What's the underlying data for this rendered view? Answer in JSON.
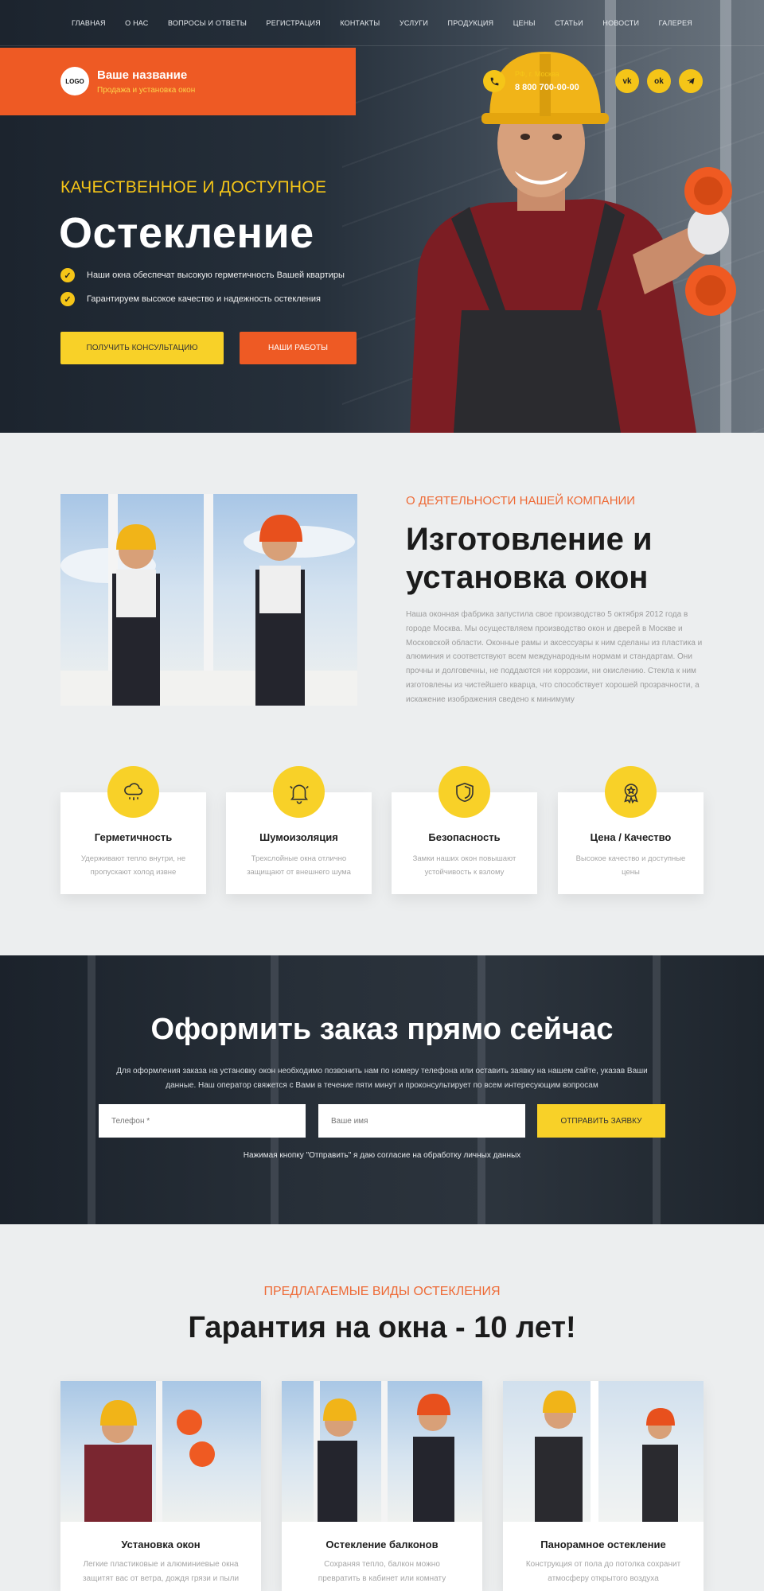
{
  "nav": [
    "ГЛАВНАЯ",
    "О НАС",
    "ВОПРОСЫ И ОТВЕТЫ",
    "РЕГИСТРАЦИЯ",
    "КОНТАКТЫ",
    "УСЛУГИ",
    "ПРОДУКЦИЯ",
    "ЦЕНЫ",
    "СТАТЬИ",
    "НОВОСТИ",
    "ГАЛЕРЕЯ"
  ],
  "brand": {
    "logo": "LOGO",
    "name": "Ваше название",
    "subtitle": "Продажа и установка окон"
  },
  "contact": {
    "city": "РФ, г. Москва",
    "phone": "8 800 700-00-00",
    "phone_icon": "phone-icon"
  },
  "social": [
    {
      "label": "vk",
      "icon": "vk-icon"
    },
    {
      "label": "ok",
      "icon": "odnoklassniki-icon"
    },
    {
      "label": "tg",
      "icon": "telegram-icon"
    }
  ],
  "hero": {
    "kicker": "КАЧЕСТВЕННОЕ И ДОСТУПНОЕ",
    "title": "Остекление",
    "checks": [
      "Наши окна обеспечат высокую герметичность Вашей квартиры",
      "Гарантируем высокое качество и надежность остекления"
    ],
    "btn_consult": "ПОЛУЧИТЬ КОНСУЛЬТАЦИЮ",
    "btn_works": "НАШИ РАБОТЫ"
  },
  "about": {
    "kicker": "О ДЕЯТЕЛЬНОСТИ НАШЕЙ КОМПАНИИ",
    "title": "Изготовление и установка окон",
    "text": "Наша оконная фабрика запустила свое производство 5 октября 2012 года в городе Москва. Мы осуществляем производство окон и дверей в Москве и Московской области. Оконные рамы и аксессуары к ним сделаны из пластика и алюминия и соответствуют всем международным нормам и стандартам. Они прочны и долговечны, не поддаются ни коррозии, ни окислению. Стекла к ним изготовлены из чистейшего кварца, что способствует хорошей прозрачности, а искажение изображения сведено к минимуму"
  },
  "features": [
    {
      "title": "Герметичность",
      "text": "Удерживают тепло внутри, не пропускают холод извне",
      "icon": "cloud-rain-icon"
    },
    {
      "title": "Шумоизоляция",
      "text": "Трехслойные окна отлично защищают от внешнего шума",
      "icon": "bell-icon"
    },
    {
      "title": "Безопасность",
      "text": "Замки наших окон повышают устойчивость к взлому",
      "icon": "shield-icon"
    },
    {
      "title": "Цена / Качество",
      "text": "Высокое качество и доступные цены",
      "icon": "award-icon"
    }
  ],
  "order": {
    "title": "Оформить заказ прямо сейчас",
    "text": "Для оформления заказа на установку окон необходимо позвонить нам по номеру телефона или оставить заявку на нашем сайте, указав Ваши данные. Наш оператор свяжется с Вами в течение пяти минут и проконсультирует по всем интересующим вопросам",
    "phone_placeholder": "Телефон *",
    "name_placeholder": "Ваше имя",
    "submit": "ОТПРАВИТЬ ЗАЯВКУ",
    "consent": "Нажимая кнопку \"Отправить\" я даю согласие на обработку личных данных"
  },
  "glazing": {
    "kicker": "ПРЕДЛАГАЕМЫЕ ВИДЫ ОСТЕКЛЕНИЯ",
    "title": "Гарантия на окна - 10 лет!",
    "cards": [
      {
        "title": "Установка окон",
        "text": "Легкие пластиковые и алюминиевые окна защитят вас от ветра, дождя грязи и пыли"
      },
      {
        "title": "Остекление балконов",
        "text": "Сохраняя тепло, балкон можно превратить в кабинет или комнату"
      },
      {
        "title": "Панорамное остекление",
        "text": "Конструкция от пола до потолка сохранит атмосферу открытого воздуха"
      }
    ]
  },
  "colors": {
    "accent_orange": "#ee5a24",
    "accent_yellow": "#f8d128",
    "dark": "#1c242e",
    "light_bg": "#eceeef"
  }
}
